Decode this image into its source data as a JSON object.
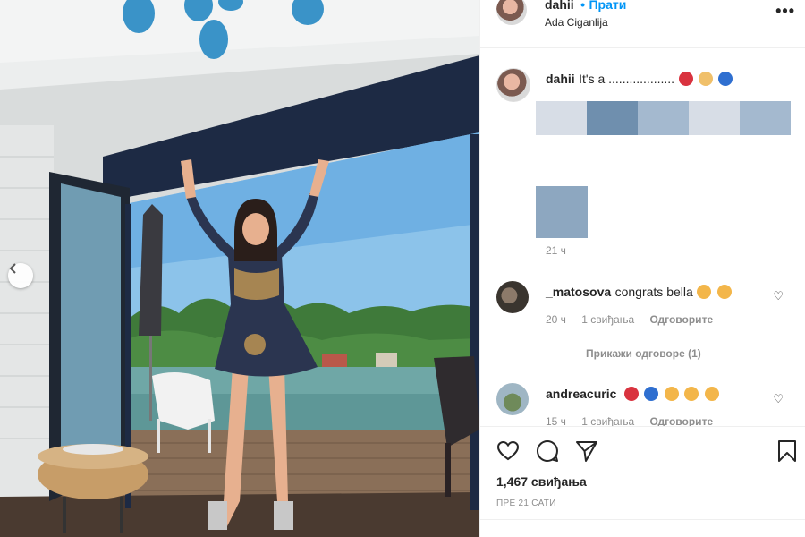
{
  "post": {
    "username": "dahii",
    "follow_label": "Прати",
    "separator": "•",
    "location": "Ada Ciganlija",
    "more_label": "•••"
  },
  "caption": {
    "username": "dahii",
    "text": "It's a ...................",
    "time": "21 ч"
  },
  "comments": [
    {
      "username": "_matosova",
      "text": "congrats bella",
      "time": "20 ч",
      "likes": "1 свиђања",
      "reply": "Одговорите"
    },
    {
      "username": "andreacuric",
      "text": "",
      "time": "15 ч",
      "likes": "1 свиђања",
      "reply": "Одговорите"
    }
  ],
  "view_replies": "Прикажи одговоре (1)",
  "actions": {
    "likes": "1,467 свиђања",
    "time_ago": "ПРЕ 21 САТИ"
  },
  "colors": {
    "follow": "#0095f6",
    "blur_swatches": [
      "#d7dde6",
      "#6f8fae",
      "#a4b9cf",
      "#d7dde6",
      "#a4b9cf"
    ],
    "blur_box": "#8da7c0"
  },
  "icons": [
    "more-options-icon",
    "heart-icon",
    "comment-icon",
    "share-icon",
    "bookmark-icon",
    "carousel-prev-icon",
    "small-heart-icon"
  ]
}
